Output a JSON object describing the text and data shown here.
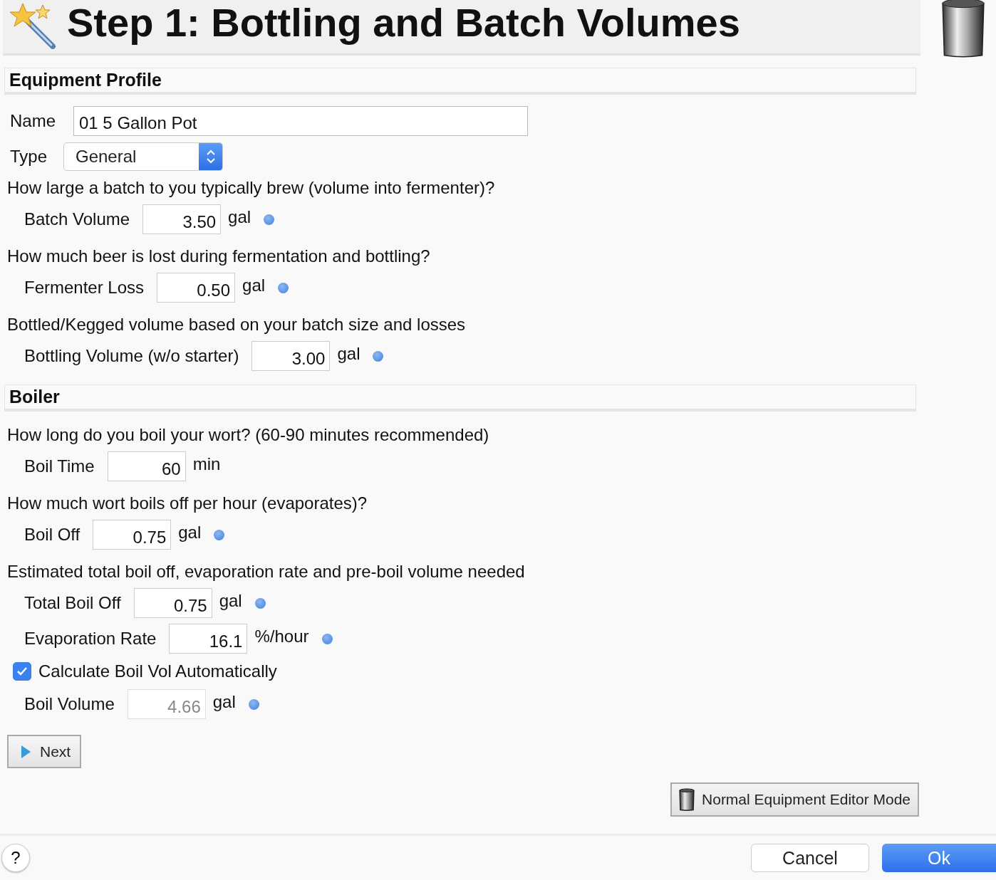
{
  "header": {
    "title": "Step 1: Bottling and Batch Volumes"
  },
  "profile": {
    "heading": "Equipment Profile",
    "name_label": "Name",
    "name_value": "01 5 Gallon Pot",
    "type_label": "Type",
    "type_value": "General",
    "rows": [
      {
        "kind": "question",
        "text": "How large a batch to you typically brew (volume into fermenter)?"
      },
      {
        "kind": "field",
        "label": "Batch Volume",
        "value": "3.50",
        "unit": "gal",
        "info_dot": true,
        "disabled": false
      },
      {
        "kind": "question",
        "text": "How much beer is lost during fermentation and bottling?"
      },
      {
        "kind": "field",
        "label": "Fermenter Loss",
        "value": "0.50",
        "unit": "gal",
        "info_dot": true,
        "disabled": false
      },
      {
        "kind": "question",
        "text": "Bottled/Kegged volume based on your batch size and losses"
      },
      {
        "kind": "field",
        "label": "Bottling Volume (w/o starter)",
        "value": "3.00",
        "unit": "gal",
        "info_dot": true,
        "disabled": false
      }
    ]
  },
  "boiler": {
    "heading": "Boiler",
    "rows": [
      {
        "kind": "question",
        "text": "How long do you boil your wort? (60-90 minutes recommended)"
      },
      {
        "kind": "field",
        "label": "Boil Time",
        "value": "60",
        "unit": "min",
        "info_dot": false,
        "disabled": false
      },
      {
        "kind": "question",
        "text": "How much wort boils off per hour (evaporates)?"
      },
      {
        "kind": "field",
        "label": "Boil Off",
        "value": "0.75",
        "unit": "gal",
        "info_dot": true,
        "disabled": false
      },
      {
        "kind": "question",
        "text": "Estimated total boil off, evaporation rate and pre-boil volume needed"
      },
      {
        "kind": "field",
        "label": "Total Boil Off",
        "value": "0.75",
        "unit": "gal",
        "info_dot": true,
        "disabled": false
      },
      {
        "kind": "field",
        "label": "Evaporation Rate",
        "value": "16.1",
        "unit": "%/hour",
        "info_dot": true,
        "disabled": false
      },
      {
        "kind": "checkbox",
        "label": "Calculate Boil Vol Automatically",
        "checked": true
      },
      {
        "kind": "field",
        "label": "Boil Volume",
        "value": "4.66",
        "unit": "gal",
        "info_dot": true,
        "disabled": true
      }
    ]
  },
  "next_button": "Next",
  "mode_button": "Normal Equipment Editor Mode",
  "footer": {
    "help": "?",
    "cancel": "Cancel",
    "ok": "Ok"
  }
}
